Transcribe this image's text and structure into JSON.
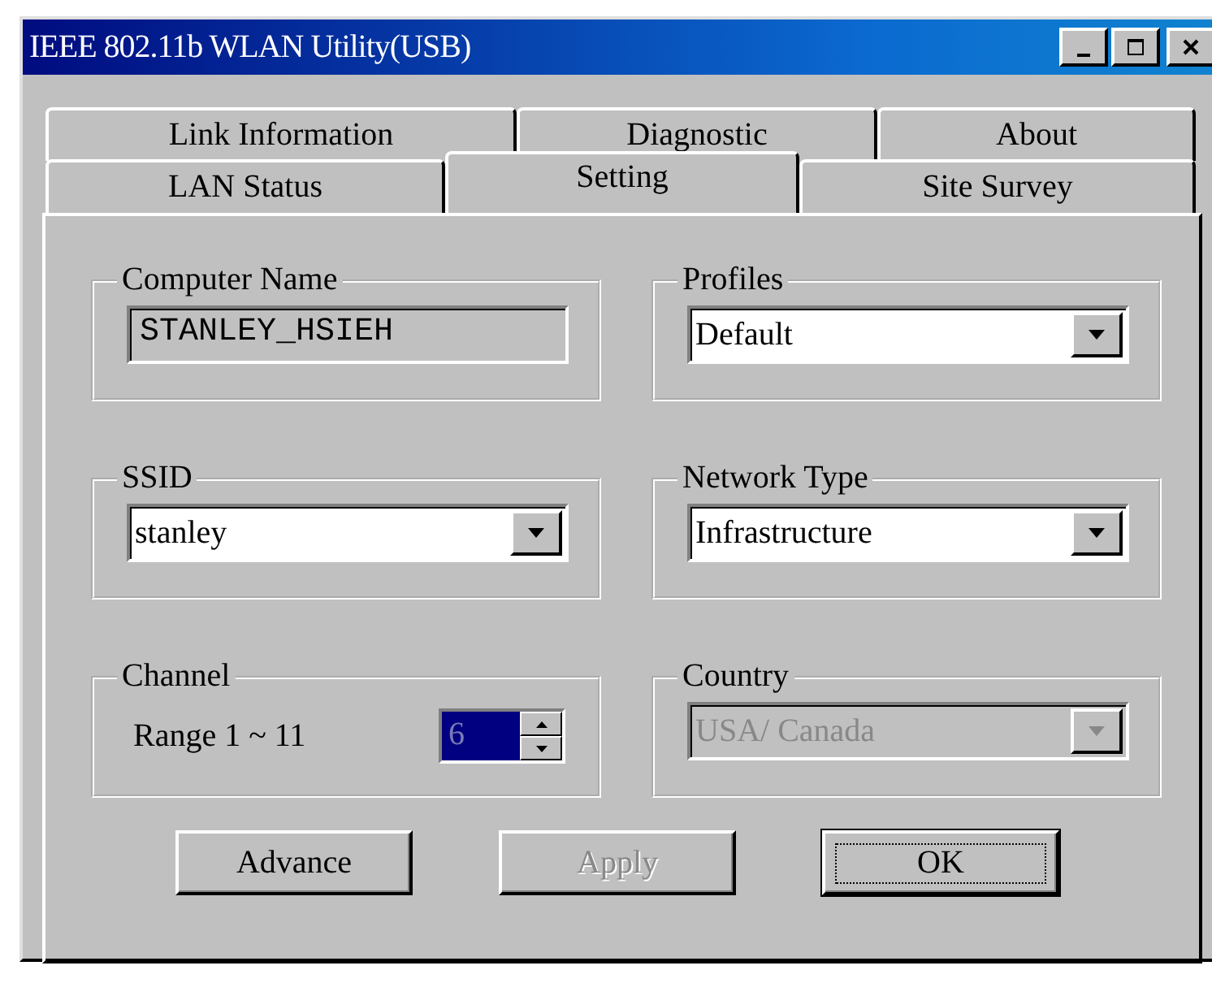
{
  "window": {
    "title": "IEEE 802.11b WLAN Utility(USB)"
  },
  "tab_rows": [
    [
      {
        "label": "Link Information",
        "selected": false
      },
      {
        "label": "Diagnostic",
        "selected": false
      },
      {
        "label": "About",
        "selected": false
      }
    ],
    [
      {
        "label": "LAN Status",
        "selected": false
      },
      {
        "label": "Setting",
        "selected": true
      },
      {
        "label": "Site Survey",
        "selected": false
      }
    ]
  ],
  "groups": [
    {
      "kind": "text",
      "label": "Computer Name",
      "value": "STANLEY_HSIEH",
      "disabled": true
    },
    {
      "kind": "dropdown",
      "label": "Profiles",
      "value": "Default",
      "disabled": false
    },
    {
      "kind": "dropdown",
      "label": "SSID",
      "value": "stanley",
      "disabled": false
    },
    {
      "kind": "dropdown",
      "label": "Network Type",
      "value": "Infrastructure",
      "disabled": false
    },
    {
      "kind": "spin",
      "label": "Channel",
      "range": "Range 1 ~ 11",
      "value": "6",
      "selected": true
    },
    {
      "kind": "dropdown",
      "label": "Country",
      "value": "USA/ Canada",
      "disabled": true
    }
  ],
  "buttons": [
    {
      "label": "Advance",
      "disabled": false,
      "default": false
    },
    {
      "label": "Apply",
      "disabled": true,
      "default": false
    },
    {
      "label": "OK",
      "disabled": false,
      "default": true
    }
  ]
}
